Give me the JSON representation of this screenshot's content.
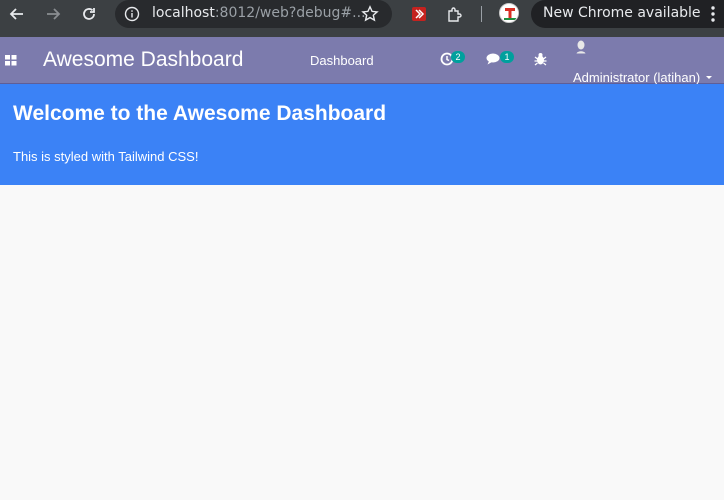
{
  "browser": {
    "url_host": "localhost",
    "url_rest": ":8012/web?debug#...",
    "update_label": "New Chrome available"
  },
  "navbar": {
    "brand": "Awesome Dashboard",
    "menu_item": "Dashboard",
    "activity_count": "2",
    "messages_count": "1",
    "user_name": "Administrator (latihan)"
  },
  "hero": {
    "title": "Welcome to the Awesome Dashboard",
    "subtitle": "This is styled with Tailwind CSS!"
  },
  "colors": {
    "chrome_bar": "#3c4043",
    "navbar": "#7c7bad",
    "hero": "#3b82f6",
    "badge": "#00a09d",
    "background": "#f9f9f9"
  }
}
